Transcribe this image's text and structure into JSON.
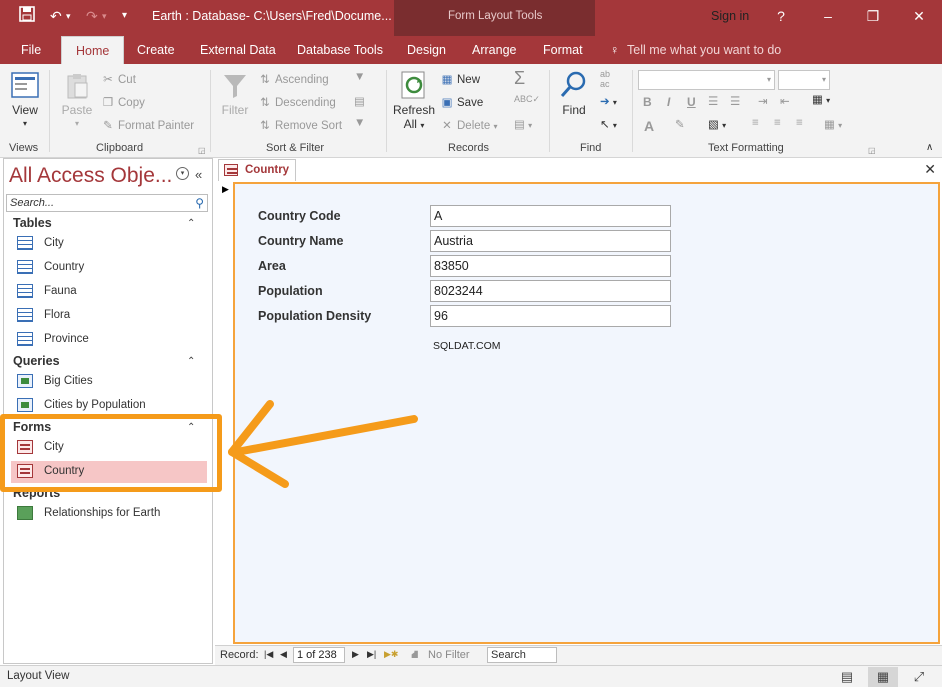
{
  "titlebar": {
    "title": "Earth : Database- C:\\Users\\Fred\\Docume...",
    "context_tools": "Form Layout Tools",
    "sign_in": "Sign in",
    "help": "?",
    "minimize": "–",
    "restore": "❐",
    "close": "✕"
  },
  "qat": {
    "save_icon": "save-icon",
    "undo_icon": "undo-icon",
    "redo_icon": "redo-icon",
    "customize_icon": "customize-qat-icon"
  },
  "tabs": [
    {
      "label": "File"
    },
    {
      "label": "Home"
    },
    {
      "label": "Create"
    },
    {
      "label": "External Data"
    },
    {
      "label": "Database Tools"
    },
    {
      "label": "Design"
    },
    {
      "label": "Arrange"
    },
    {
      "label": "Format"
    }
  ],
  "tell_me": "Tell me what you want to do",
  "ribbon": {
    "views": {
      "view_label": "View",
      "group": "Views"
    },
    "clipboard": {
      "paste": "Paste",
      "cut": "Cut",
      "copy": "Copy",
      "format_painter": "Format Painter",
      "group": "Clipboard"
    },
    "sort_filter": {
      "filter": "Filter",
      "ascending": "Ascending",
      "descending": "Descending",
      "remove_sort": "Remove Sort",
      "group": "Sort & Filter"
    },
    "records": {
      "refresh": "Refresh",
      "refresh_all": "All",
      "new": "New",
      "save": "Save",
      "delete": "Delete",
      "group": "Records"
    },
    "find": {
      "find": "Find",
      "group": "Find"
    },
    "text_formatting": {
      "bold": "B",
      "italic": "I",
      "underline": "U",
      "font_color": "A",
      "group": "Text Formatting"
    }
  },
  "nav": {
    "title": "All Access Obje...",
    "search_placeholder": "Search...",
    "groups": [
      {
        "name": "Tables",
        "items": [
          "City",
          "Country",
          "Fauna",
          "Flora",
          "Province"
        ]
      },
      {
        "name": "Queries",
        "items": [
          "Big Cities",
          "Cities by Population"
        ]
      },
      {
        "name": "Forms",
        "items": [
          "City",
          "Country"
        ]
      },
      {
        "name": "Reports",
        "items": [
          "Relationships for Earth"
        ]
      }
    ],
    "selected": "Forms/Country"
  },
  "document": {
    "tab_label": "Country",
    "fields": [
      {
        "label": "Country Code",
        "value": "A"
      },
      {
        "label": "Country Name",
        "value": "Austria"
      },
      {
        "label": "Area",
        "value": "83850"
      },
      {
        "label": "Population",
        "value": "8023244"
      },
      {
        "label": "Population Density",
        "value": "96"
      }
    ],
    "watermark": "SQLDAT.COM"
  },
  "record_nav": {
    "label": "Record:",
    "position": "1 of 238",
    "filter": "No Filter",
    "search": "Search"
  },
  "status": {
    "text": "Layout View"
  },
  "colors": {
    "accent": "#a4373a",
    "highlight": "#f59b1a",
    "selected_row": "#f6c6c6"
  }
}
